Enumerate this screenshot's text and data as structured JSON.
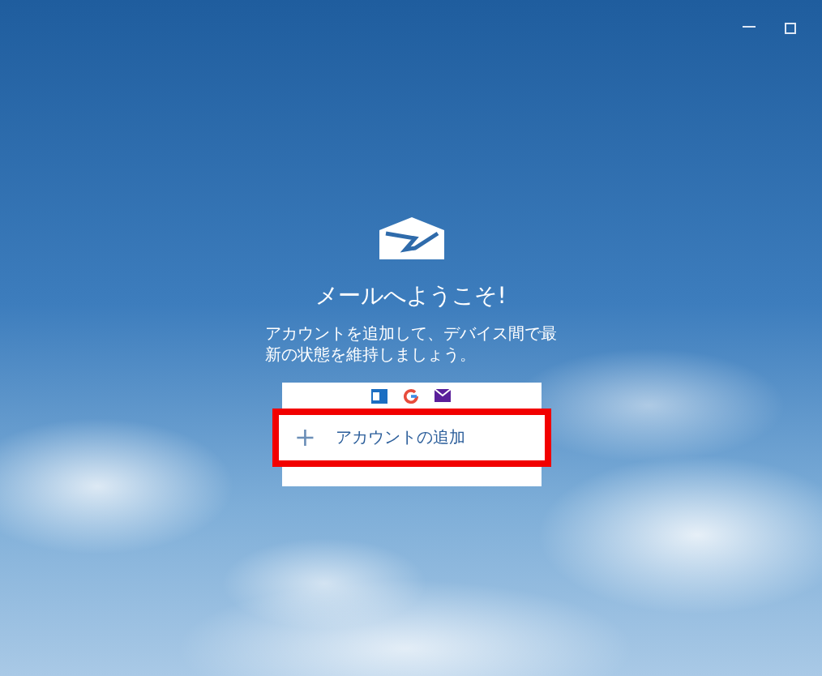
{
  "window": {
    "controls": [
      {
        "kind": "minimize"
      },
      {
        "kind": "maximize"
      }
    ]
  },
  "welcome": {
    "title": "メールへようこそ!",
    "subtitle": "アカウントを追加して、デバイス間で最新の状態を維持しましょう。"
  },
  "providers": [
    {
      "kind": "outlook"
    },
    {
      "kind": "google"
    },
    {
      "kind": "yahoo"
    }
  ],
  "add_account": {
    "icon": "+",
    "label": "アカウントの追加",
    "highlighted": true
  }
}
